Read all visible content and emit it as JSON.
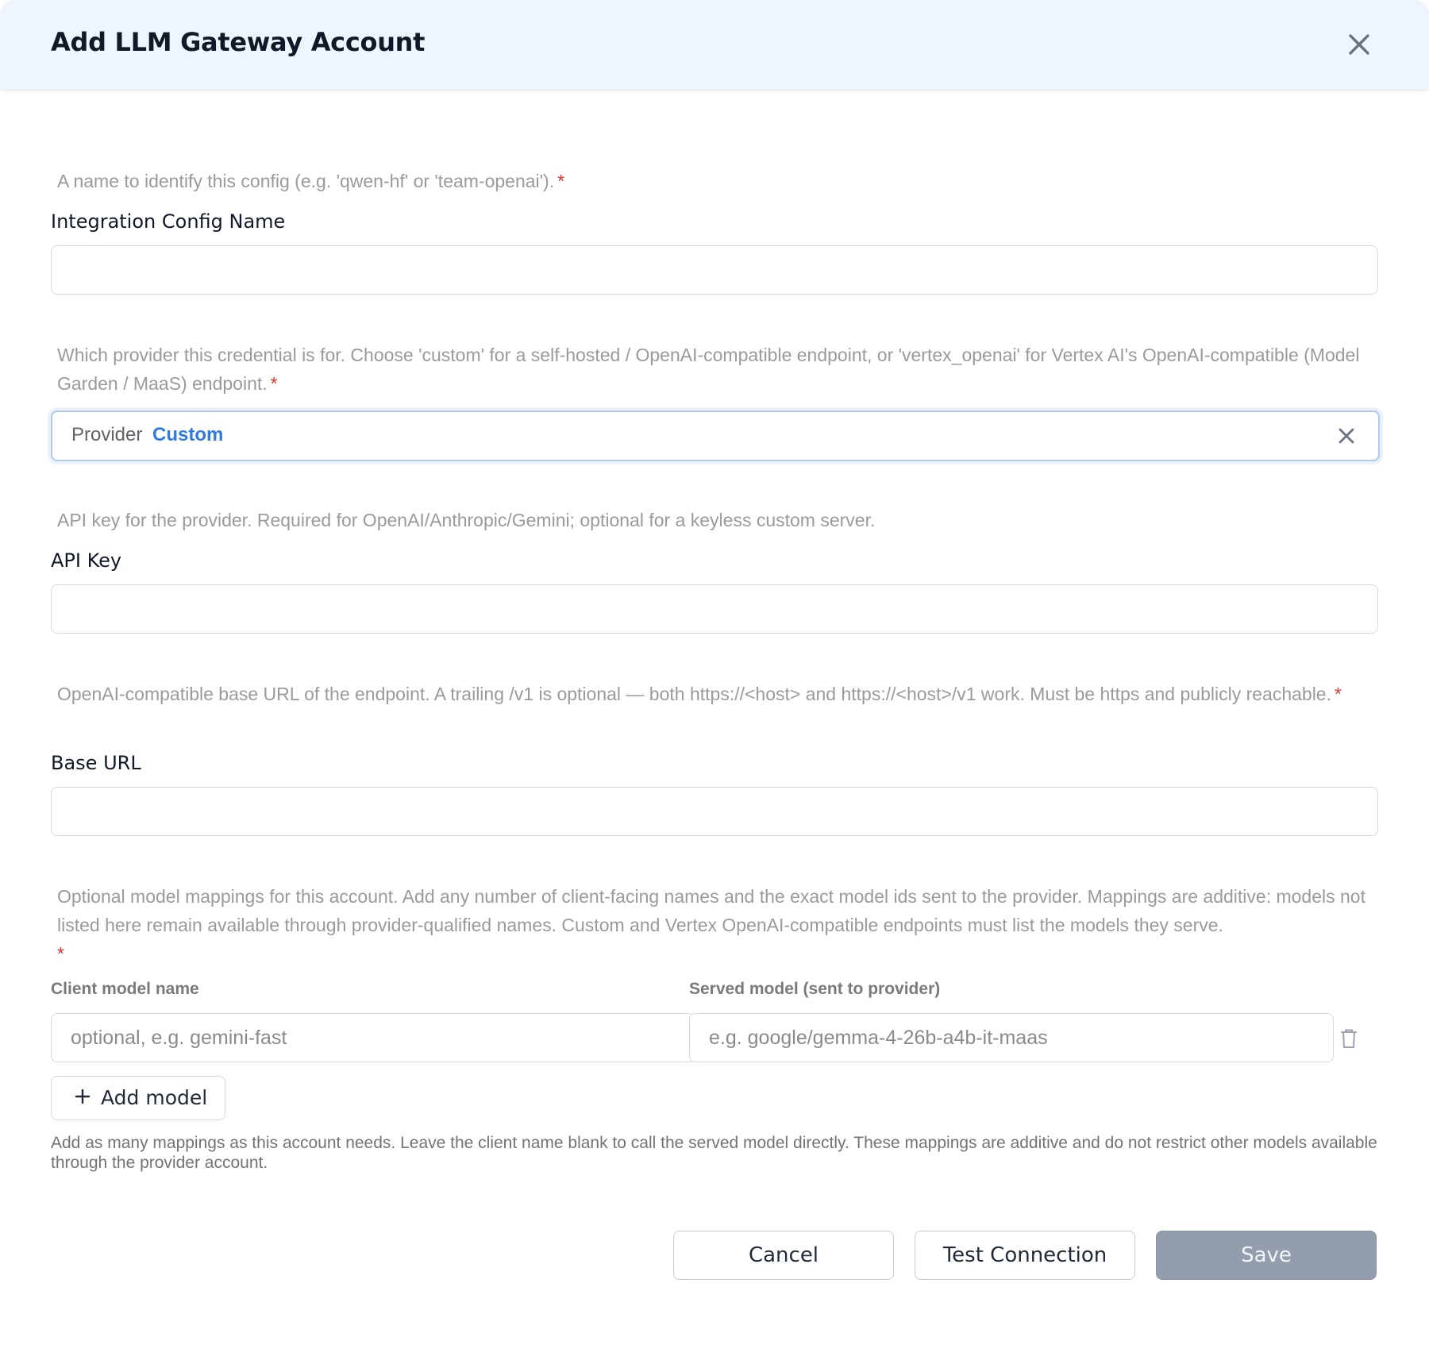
{
  "dialog": {
    "title": "Add LLM Gateway Account",
    "close_icon": "close-icon"
  },
  "fields": {
    "config_name": {
      "description": "A name to identify this config (e.g. 'qwen-hf' or 'team-openai').",
      "required_mark": "*",
      "label": "Integration Config Name",
      "value": ""
    },
    "provider": {
      "description": "Which provider this credential is for. Choose 'custom' for a self-hosted / OpenAI-compatible endpoint, or 'vertex_openai' for Vertex AI's OpenAI-compatible (Model Garden / MaaS) endpoint.",
      "required_mark": "*",
      "label": "Provider",
      "value": "Custom",
      "clear_icon": "clear-icon"
    },
    "api_key": {
      "description": "API key for the provider. Required for OpenAI/Anthropic/Gemini; optional for a keyless custom server.",
      "label": "API Key",
      "value": ""
    },
    "base_url": {
      "description": "OpenAI-compatible base URL of the endpoint. A trailing /v1 is optional — both https://<host> and https://<host>/v1 work. Must be https and publicly reachable.",
      "required_mark": "*",
      "label": "Base URL",
      "value": ""
    },
    "model_mappings": {
      "description": "Optional model mappings for this account. Add any number of client-facing names and the exact model ids sent to the provider. Mappings are additive: models not listed here remain available through provider-qualified names. Custom and Vertex OpenAI-compatible endpoints must list the models they serve.",
      "required_mark": "*",
      "client_label": "Client model name",
      "served_label": "Served model (sent to provider)",
      "rows": [
        {
          "client_value": "",
          "client_placeholder": "optional, e.g. gemini-fast",
          "served_value": "",
          "served_placeholder": "e.g. google/gemma-4-26b-a4b-it-maas"
        }
      ],
      "add_label": "Add model",
      "helper": "Add as many mappings as this account needs. Leave the client name blank to call the served model directly. These mappings are additive and do not restrict other models available through the provider account."
    }
  },
  "actions": {
    "cancel": "Cancel",
    "test": "Test Connection",
    "save": "Save"
  },
  "colors": {
    "header_bg": "#eef5fe",
    "accent": "#2f7be0",
    "required": "#e0342f",
    "save_disabled": "#939dac"
  }
}
